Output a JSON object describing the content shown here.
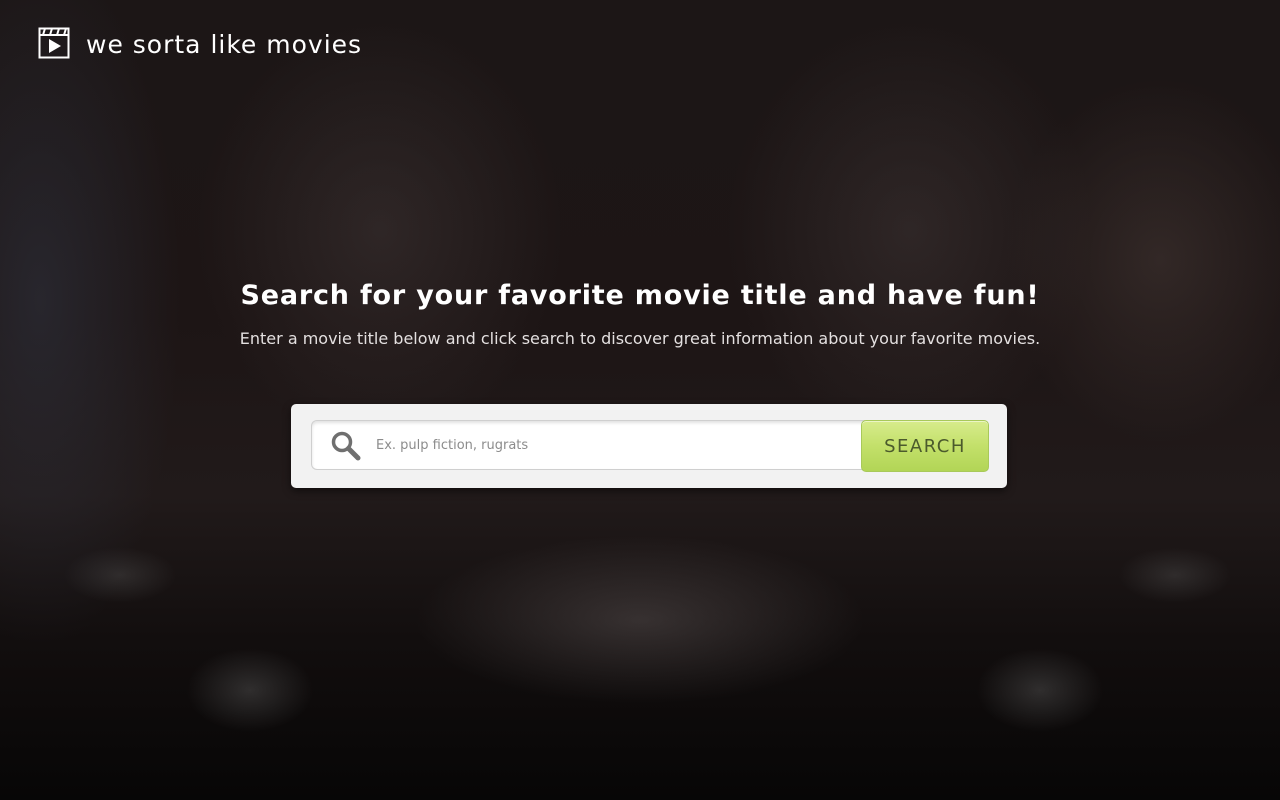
{
  "brand": {
    "name": "we sorta like movies",
    "icon": "film-play-icon"
  },
  "hero": {
    "title": "Search for your favorite movie title and have fun!",
    "subtitle": "Enter a movie title below and click search to discover great information about your favorite movies."
  },
  "search": {
    "placeholder": "Ex. pulp fiction, rugrats",
    "value": "",
    "icon": "search-icon",
    "button_label": "SEARCH"
  },
  "colors": {
    "button_green": "#c3e06a",
    "button_text": "#4b5a2c",
    "panel": "#f2f2f2",
    "background": "#1d1515"
  }
}
